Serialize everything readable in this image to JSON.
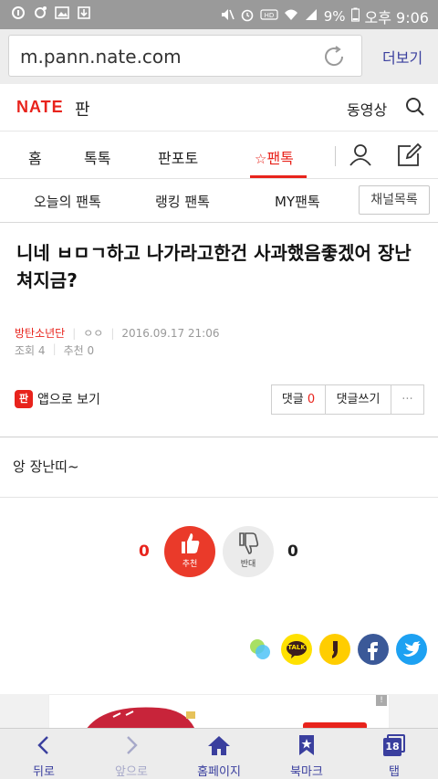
{
  "status_bar": {
    "battery": "9%",
    "time": "오후 9:06"
  },
  "browser": {
    "url": "m.pann.nate.com",
    "more_label": "더보기"
  },
  "header": {
    "logo": "NATE",
    "service": "판",
    "video_label": "동영상"
  },
  "main_tabs": [
    {
      "label": "홈"
    },
    {
      "label": "톡톡"
    },
    {
      "label": "판포토"
    },
    {
      "label": "팬톡",
      "active": true
    }
  ],
  "sub_tabs": [
    {
      "label": "오늘의 팬톡"
    },
    {
      "label": "랭킹 팬톡"
    },
    {
      "label": "MY팬톡"
    }
  ],
  "channel_button": "채널목록",
  "post": {
    "title": "니네 ㅂㅁㄱ하고 나가라고한건 사과했음좋겠어 장난쳐지금?",
    "author_tag": "방탄소년단",
    "author_name": "ㅇㅇ",
    "date": "2016.09.17 21:06",
    "views_label": "조회",
    "views": "4",
    "recommend_label": "추천",
    "recommends": "0",
    "body": "앙 장난띠~"
  },
  "actions": {
    "app_icon_text": "판",
    "app_view": "앱으로 보기",
    "comment_label": "댓글",
    "comment_count": "0",
    "write_comment": "댓글쓰기",
    "more": "···"
  },
  "vote": {
    "up_count": "0",
    "up_label": "추천",
    "down_label": "반대",
    "down_count": "0"
  },
  "share_icons": [
    "band-icon",
    "kakaotalk-icon",
    "kakaostory-icon",
    "facebook-icon",
    "twitter-icon"
  ],
  "share": {
    "talk_label": "TALK"
  },
  "bottom_nav": [
    {
      "label": "뒤로",
      "icon": "back-icon"
    },
    {
      "label": "앞으로",
      "icon": "forward-icon"
    },
    {
      "label": "홈페이지",
      "icon": "home-icon"
    },
    {
      "label": "북마크",
      "icon": "bookmark-icon"
    },
    {
      "label": "탭",
      "icon": "tabs-icon",
      "badge": "18"
    }
  ],
  "colors": {
    "accent": "#e8231c",
    "browser_blue": "#3a3f9e",
    "status_bar": "#9a9a9a"
  }
}
